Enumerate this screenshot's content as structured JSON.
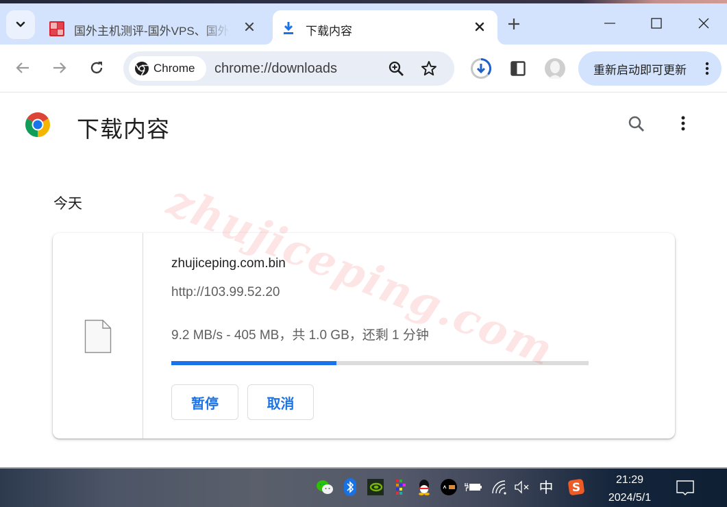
{
  "browser": {
    "tabs": [
      {
        "title": "国外主机测评-国外VPS、国外服务器",
        "favicon": "zhujiceping-logo-icon",
        "active": false
      },
      {
        "title": "下载内容",
        "favicon": "download-icon",
        "active": true
      }
    ],
    "new_tab_label": "+",
    "omnibox": {
      "chip_label": "Chrome",
      "url": "chrome://downloads"
    },
    "update_button_label": "重新启动即可更新",
    "colors": {
      "tabstrip": "#d3e3fd",
      "accent": "#1a73e8"
    }
  },
  "page": {
    "title": "下载内容",
    "date_group": "今天",
    "downloads": [
      {
        "file_name": "zhujiceping.com.bin",
        "source_url": "http://103.99.52.20",
        "status": "9.2 MB/s - 405 MB，共 1.0 GB，还剩 1 分钟",
        "progress_percent": 39.5,
        "actions": {
          "pause": "暂停",
          "cancel": "取消"
        }
      }
    ],
    "watermark": "zhujiceping.com"
  },
  "taskbar": {
    "tray_icons": [
      "wechat-icon",
      "bluetooth-icon",
      "nvidia-icon",
      "color-grid-icon",
      "qq-icon",
      "media-app-icon",
      "battery-charging-icon",
      "wifi-icon",
      "volume-muted-icon",
      "ime-chinese-icon",
      "sogou-input-icon"
    ],
    "ime_label": "中",
    "sogou_label": "S",
    "time": "21:29",
    "date": "2024/5/1"
  }
}
